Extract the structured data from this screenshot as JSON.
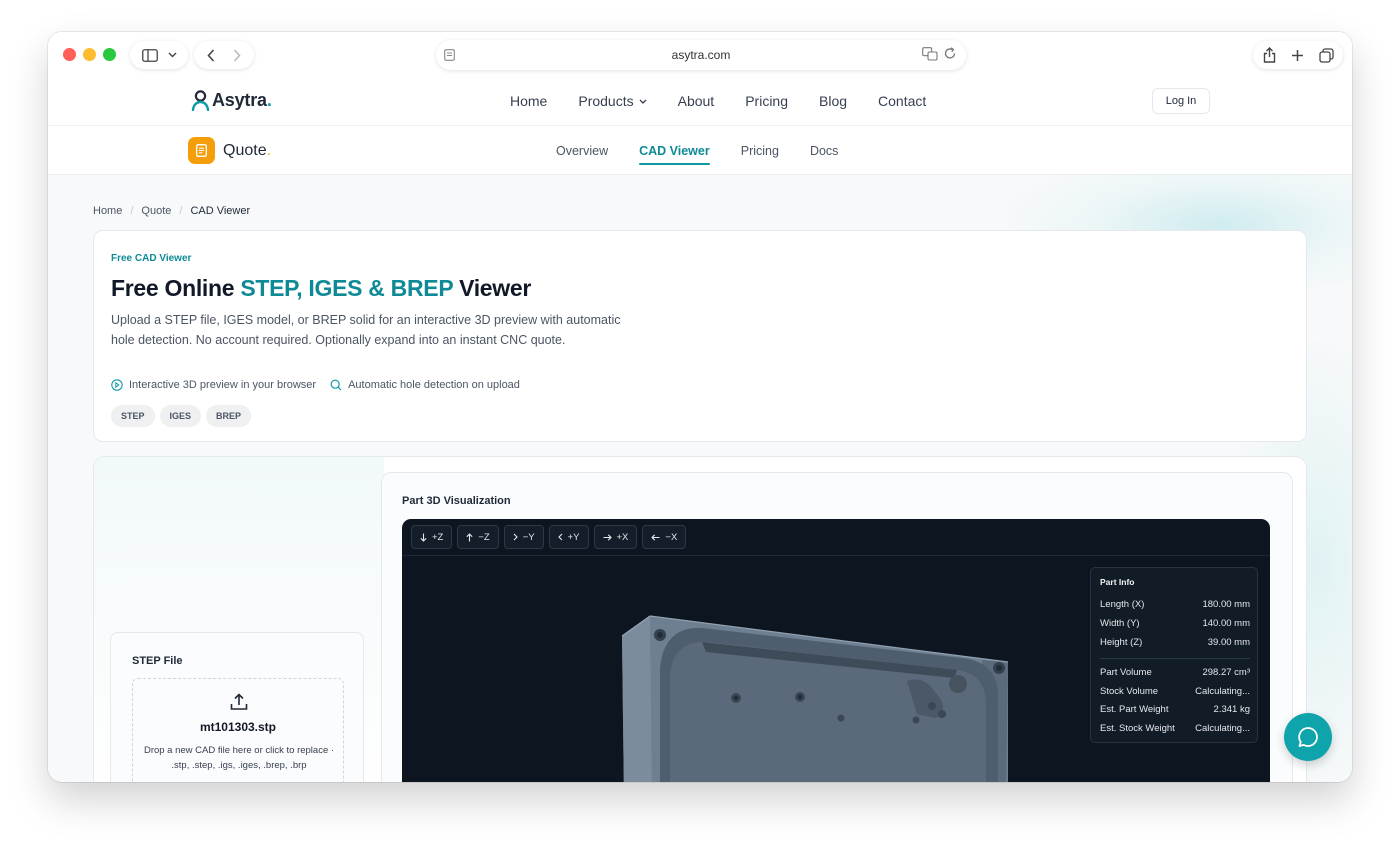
{
  "browser": {
    "url": "asytra.com"
  },
  "site": {
    "logo": "Asytra",
    "nav": [
      "Home",
      "Products",
      "About",
      "Pricing",
      "Blog",
      "Contact"
    ],
    "login_label": "Log In"
  },
  "product": {
    "logo": "Quote",
    "tabs": [
      "Overview",
      "CAD Viewer",
      "Pricing",
      "Docs"
    ],
    "active_tab": "CAD Viewer"
  },
  "breadcrumb": [
    "Home",
    "Quote",
    "CAD Viewer"
  ],
  "hero": {
    "eyebrow": "Free CAD Viewer",
    "title_prefix": "Free Online",
    "title_accent": "STEP, IGES & BREP",
    "title_suffix": "Viewer",
    "description": "Upload a STEP file, IGES model, or BREP solid for an interactive 3D preview with automatic hole detection. No account required. Optionally expand into an instant CNC quote.",
    "features": [
      "Interactive 3D preview in your browser",
      "Automatic hole detection on upload"
    ],
    "formats": [
      "STEP",
      "IGES",
      "BREP"
    ]
  },
  "upload": {
    "title": "STEP File",
    "filename": "mt101303.stp",
    "hint": "Drop a new CAD file here or click to replace · .stp, .step, .igs, .iges, .brep, .brp"
  },
  "visualization": {
    "title": "Part 3D Visualization",
    "view_buttons": [
      {
        "icon": "arrow-down-icon",
        "label": "+Z"
      },
      {
        "icon": "arrow-up-icon",
        "label": "−Z"
      },
      {
        "icon": "chevron-right-icon",
        "label": "−Y"
      },
      {
        "icon": "chevron-left-icon",
        "label": "+Y"
      },
      {
        "icon": "arrow-right-icon",
        "label": "+X"
      },
      {
        "icon": "arrow-left-icon",
        "label": "−X"
      }
    ],
    "part_info": {
      "title": "Part Info",
      "dimensions": [
        {
          "label": "Length (X)",
          "value": "180.00 mm"
        },
        {
          "label": "Width (Y)",
          "value": "140.00 mm"
        },
        {
          "label": "Height (Z)",
          "value": "39.00 mm"
        }
      ],
      "metrics": [
        {
          "label": "Part Volume",
          "value": "298.27 cm³"
        },
        {
          "label": "Stock Volume",
          "value": "Calculating..."
        },
        {
          "label": "Est. Part Weight",
          "value": "2.341 kg"
        },
        {
          "label": "Est. Stock Weight",
          "value": "Calculating..."
        }
      ]
    }
  },
  "colors": {
    "accent": "#0e8a96",
    "quote_brand": "#f59e0b",
    "viewer_bg": "#0d1620"
  }
}
